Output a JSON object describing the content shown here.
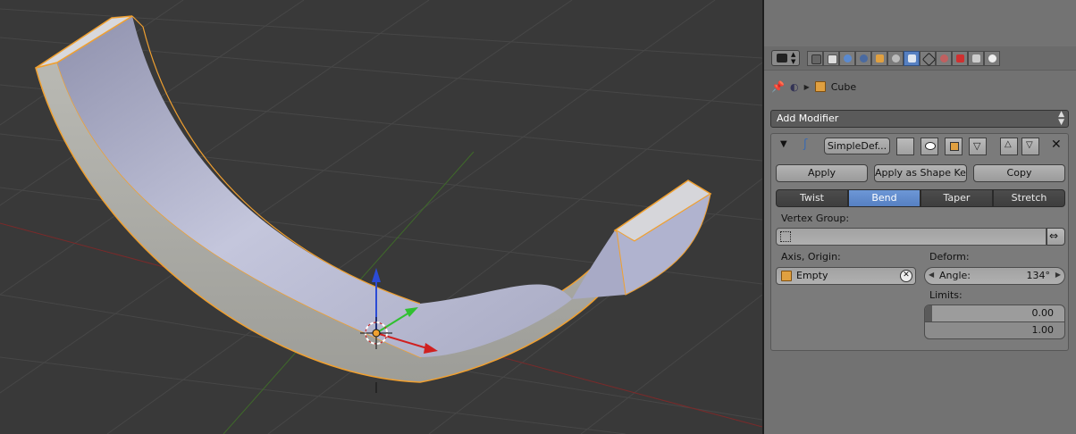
{
  "properties": {
    "breadcrumb": {
      "object_name": "Cube"
    },
    "add_modifier_label": "Add Modifier",
    "modifier": {
      "name": "SimpleDef...",
      "buttons": {
        "apply": "Apply",
        "apply_shape_key": "Apply as Shape Key",
        "copy": "Copy"
      },
      "modes": [
        "Twist",
        "Bend",
        "Taper",
        "Stretch"
      ],
      "active_mode": "Bend",
      "vertex_group_label": "Vertex Group:",
      "vertex_group_value": "",
      "axis_origin_label": "Axis, Origin:",
      "origin_object": "Empty",
      "deform_label": "Deform:",
      "angle_label": "Angle:",
      "angle_value": "134°",
      "limits_label": "Limits:",
      "limit_min": "0.00",
      "limit_max": "1.00"
    }
  },
  "colors": {
    "accent": "#5680c2",
    "viewport_bg": "#393939",
    "panel_bg": "#727272",
    "mesh": "#b8bad0",
    "selection_outline": "#f0a030"
  },
  "icons": [
    "render-tab-icon",
    "render-layers-tab-icon",
    "scene-tab-icon",
    "world-tab-icon",
    "object-tab-icon",
    "constraints-tab-icon",
    "modifiers-tab-icon",
    "data-tab-icon",
    "material-tab-icon",
    "texture-tab-icon",
    "particles-tab-icon",
    "physics-tab-icon"
  ]
}
